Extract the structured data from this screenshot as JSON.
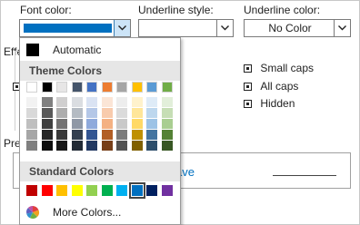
{
  "font_color": {
    "label": "Font color:",
    "selected_color": "#0070c0"
  },
  "underline_style": {
    "label": "Underline style:",
    "value": ""
  },
  "underline_color": {
    "label": "Underline color:",
    "value": "No Color"
  },
  "effects": {
    "group_label": "Effe",
    "right_options": [
      {
        "label": "Small caps",
        "checked": "mixed"
      },
      {
        "label": "All caps",
        "checked": "mixed"
      },
      {
        "label": "Hidden",
        "checked": "mixed"
      }
    ]
  },
  "preview": {
    "group_label": "Pre",
    "sample_text": "ave"
  },
  "color_menu": {
    "automatic_label": "Automatic",
    "automatic_color": "#000000",
    "theme_header": "Theme Colors",
    "theme_colors": [
      "#ffffff",
      "#000000",
      "#e7e6e6",
      "#44546a",
      "#4472c4",
      "#ed7d31",
      "#a5a5a5",
      "#ffc000",
      "#5b9bd5",
      "#70ad47"
    ],
    "standard_header": "Standard Colors",
    "standard_colors": [
      "#c00000",
      "#ff0000",
      "#ffc000",
      "#ffff00",
      "#92d050",
      "#00b050",
      "#00b0f0",
      "#0070c0",
      "#002060",
      "#7030a0"
    ],
    "standard_selected_index": 7,
    "more_colors_label": "More Colors..."
  }
}
